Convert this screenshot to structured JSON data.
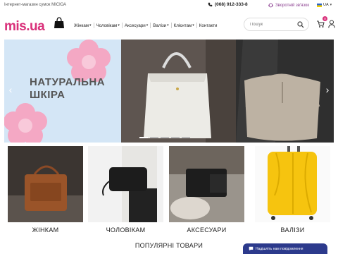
{
  "topbar": {
    "tagline": "Інтернет-магазин сумок МІСЮА",
    "phone": "(068) 912-333-8",
    "callback": "Зворотній зв'язок",
    "lang": "UA"
  },
  "header": {
    "logo": "mis.ua",
    "nav": [
      {
        "label": "Жінкам"
      },
      {
        "label": "Чоловікам"
      },
      {
        "label": "Аксесуари"
      },
      {
        "label": "Валізи"
      },
      {
        "label": "Клієнтам"
      },
      {
        "label": "Контакти"
      }
    ],
    "search_placeholder": "Пошук",
    "cart_count": "0"
  },
  "hero": {
    "title_line1": "НАТУРАЛЬНА",
    "title_line2": "ШКІРА"
  },
  "categories": [
    {
      "label": "ЖІНКАМ"
    },
    {
      "label": "ЧОЛОВІКАМ"
    },
    {
      "label": "АКСЕСУАРИ"
    },
    {
      "label": "ВАЛІЗИ"
    }
  ],
  "popular_title": "ПОПУЛЯРНІ ТОВАРИ",
  "chat_label": "Надішліть нам повідомлення",
  "colors": {
    "brand": "#d9307a",
    "chat": "#2c3a8c"
  }
}
